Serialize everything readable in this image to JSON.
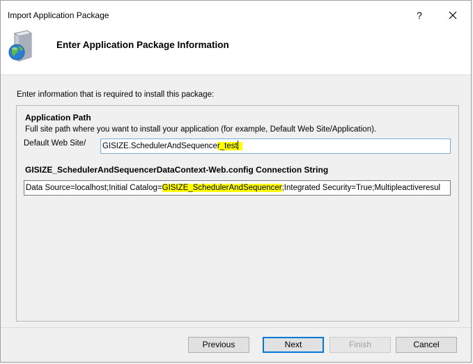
{
  "window": {
    "title": "Import Application Package",
    "help_glyph": "?"
  },
  "header": {
    "title": "Enter Application Package Information",
    "icon": "package-globe-icon"
  },
  "instruction": "Enter information that is required to install this package:",
  "app_path": {
    "section_title": "Application Path",
    "description": "Full site path where you want to install your application (for example, Default Web Site/Application).",
    "label": "Default Web Site/",
    "value_main": "GISIZE.SchedulerAndSequence",
    "value_highlight": "r_test"
  },
  "connection": {
    "section_title": "GISIZE_SchedulerAndSequencerDataContext-Web.config Connection String",
    "value_before": "Data Source=localhost;Initial Catalog=",
    "value_highlight": "GISIZE_SchedulerAndSequencer",
    "value_after": ";Integrated Security=True;Multipleactiveresul"
  },
  "buttons": {
    "previous": "Previous",
    "next": "Next",
    "finish": "Finish",
    "cancel": "Cancel"
  },
  "colors": {
    "highlight": "#ffff00",
    "focus_border": "#0078d7"
  }
}
